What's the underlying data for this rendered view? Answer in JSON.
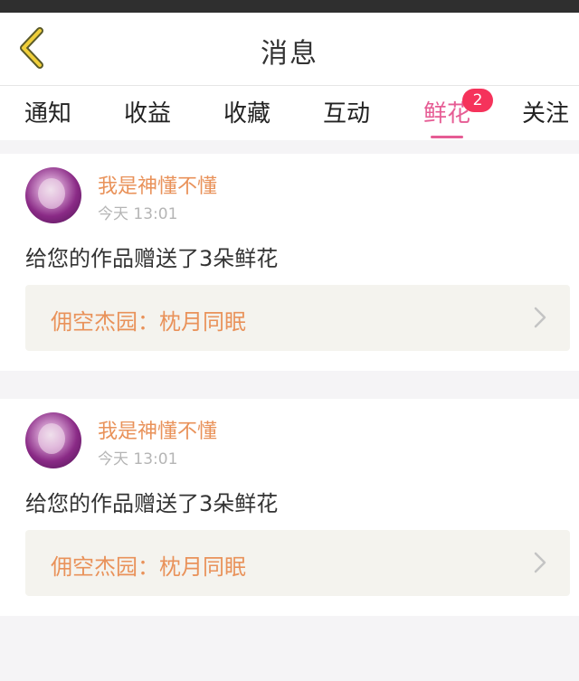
{
  "header": {
    "title": "消息",
    "back_icon": "chevron-left-icon"
  },
  "tabs": [
    {
      "label": "通知"
    },
    {
      "label": "收益"
    },
    {
      "label": "收藏"
    },
    {
      "label": "互动"
    },
    {
      "label": "鲜花",
      "badge": "2",
      "active": true
    },
    {
      "label": "关注"
    }
  ],
  "notifications": [
    {
      "username": "我是神懂不懂",
      "time": "今天 13:01",
      "message": "给您的作品赠送了3朵鲜花",
      "work_title": "佣空杰园：枕月同眠"
    },
    {
      "username": "我是神懂不懂",
      "time": "今天 13:01",
      "message": "给您的作品赠送了3朵鲜花",
      "work_title": "佣空杰园：枕月同眠"
    }
  ],
  "colors": {
    "accent_tab": "#e65c94",
    "username": "#e9925a",
    "badge": "#f5335b",
    "back_icon": "#f0cf3a"
  }
}
